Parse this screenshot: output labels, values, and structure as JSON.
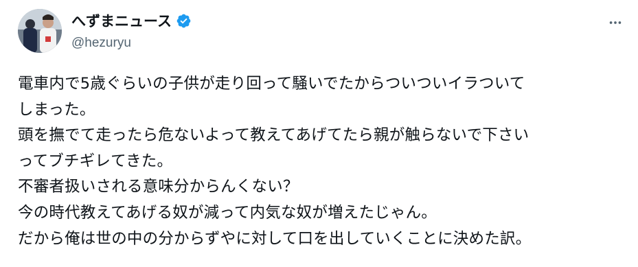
{
  "tweet": {
    "author": {
      "display_name": "へずまニュース",
      "handle": "@hezuryu",
      "verified": true,
      "avatar_icon": "user-photo-avatar"
    },
    "more_icon": "more-horizontal-icon",
    "verified_icon": "verified-badge-icon",
    "text_lines": [
      "電車内で5歳ぐらいの子供が走り回って騒いでたからついついイラついて",
      "しまった。",
      "頭を撫でて走ったら危ないよって教えてあげてたら親が触らないで下さい",
      "ってブチギレてきた。",
      "不審者扱いされる意味分からんくない？",
      "今の時代教えてあげる奴が減って内気な奴が増えたじゃん。",
      "だから俺は世の中の分からずやに対して口を出していくことに決めた訳。"
    ]
  },
  "colors": {
    "text_primary": "#0f1419",
    "text_secondary": "#536471",
    "verified_blue": "#1d9bf0",
    "background": "#ffffff"
  }
}
